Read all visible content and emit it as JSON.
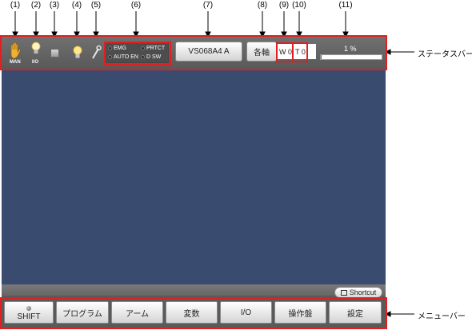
{
  "callouts": [
    "(1)",
    "(2)",
    "(3)",
    "(4)",
    "(5)",
    "(6)",
    "(7)",
    "(8)",
    "(9)",
    "(10)",
    "(11)"
  ],
  "side_labels": {
    "status_bar": "ステータスバー",
    "menu_bar": "メニューバー"
  },
  "status_bar": {
    "man_label": "MAN",
    "io_label": "I/O",
    "indicators": [
      "EMG",
      "PRTCT",
      "AUTO EN",
      "D SW"
    ],
    "robot_name": "VS068A4 A",
    "axis_button": "各軸",
    "work_label": "W 0",
    "tool_label": "T 0",
    "speed_text": "1 %",
    "speed_value": 1
  },
  "shortcut_label": "Shortcut",
  "menu": [
    "SHIFT",
    "プログラム",
    "アーム",
    "変数",
    "I/O",
    "操作盤",
    "設定"
  ],
  "colors": {
    "accent_red": "#e02020",
    "panel_blue": "#394c70",
    "bar_gray": "#5a5a5a"
  }
}
